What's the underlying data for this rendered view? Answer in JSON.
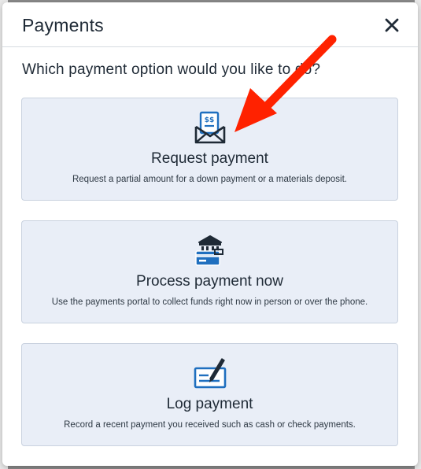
{
  "modal": {
    "title": "Payments",
    "question": "Which payment option would you like to do?"
  },
  "options": [
    {
      "icon": "envelope-invoice-icon",
      "title": "Request payment",
      "description": "Request a partial amount for a down payment or a materials deposit."
    },
    {
      "icon": "bank-card-icon",
      "title": "Process payment now",
      "description": "Use the payments portal to collect funds right now in person or over the phone."
    },
    {
      "icon": "check-pen-icon",
      "title": "Log payment",
      "description": "Record a recent payment you received such as cash or check payments."
    }
  ],
  "colors": {
    "card_background": "#e9eef7",
    "icon_blue": "#1f6fbf",
    "icon_dark": "#1f2a36",
    "annotation_arrow": "#ff2200"
  }
}
